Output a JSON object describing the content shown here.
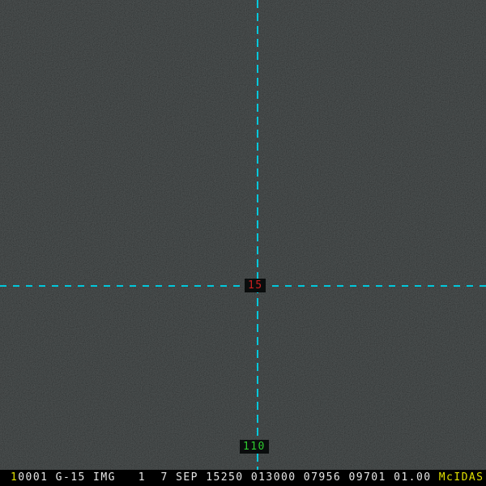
{
  "colors": {
    "background": "#0A0D0D",
    "status_bar_background": "#000000",
    "grid_line": "#00C8DC",
    "latitude_label_color": "#CC2020",
    "longitude_label_color": "#2FCC2F",
    "status_text_color": "#E8E8E8",
    "highlight_yellow": "#E0E000"
  },
  "image_display": {
    "latitude_label": "15",
    "longitude_label": "110"
  },
  "status_bar": {
    "frame_number": "1",
    "image_info": "0001 G-15 IMG   1  7 SEP 15250 013000 07956 09701 01.00 ",
    "brand": "McIDAS"
  }
}
